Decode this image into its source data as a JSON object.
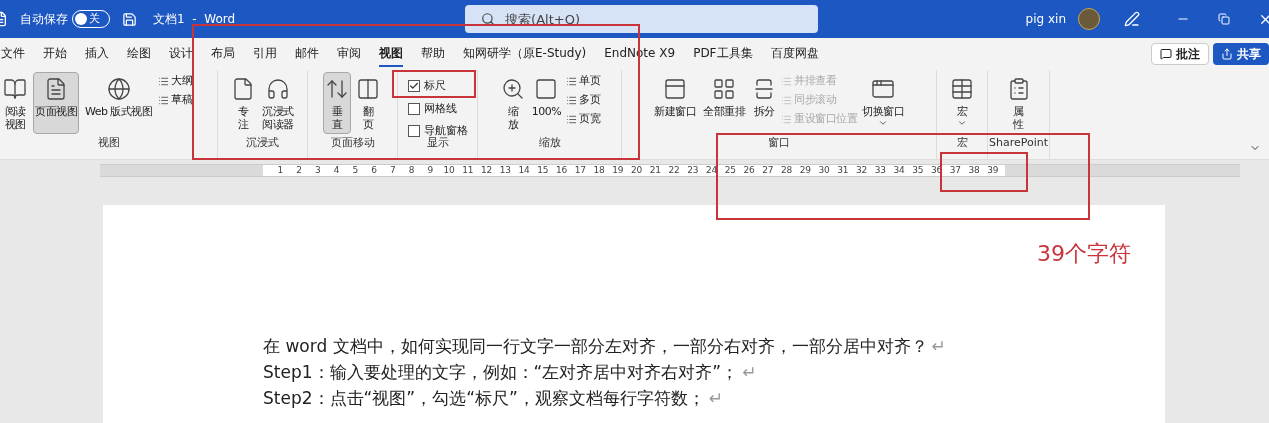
{
  "title_bar": {
    "autosave_label": "自动保存",
    "autosave_toggle": {
      "on": false,
      "label": "关"
    },
    "doc_title": "文档1  -  Word",
    "search": {
      "placeholder": "搜索(Alt+Q)"
    },
    "user_name": "pig xin"
  },
  "menu_tabs": [
    {
      "label": "文件",
      "selected": false
    },
    {
      "label": "开始",
      "selected": false
    },
    {
      "label": "插入",
      "selected": false
    },
    {
      "label": "绘图",
      "selected": false
    },
    {
      "label": "设计",
      "selected": false
    },
    {
      "label": "布局",
      "selected": false
    },
    {
      "label": "引用",
      "selected": false
    },
    {
      "label": "邮件",
      "selected": false
    },
    {
      "label": "审阅",
      "selected": false
    },
    {
      "label": "视图",
      "selected": true
    },
    {
      "label": "帮助",
      "selected": false
    },
    {
      "label": "知网研学（原E-Study)",
      "selected": false
    },
    {
      "label": "EndNote X9",
      "selected": false
    },
    {
      "label": "PDF工具集",
      "selected": false
    },
    {
      "label": "百度网盘",
      "selected": false
    }
  ],
  "right_buttons": [
    {
      "label": "批注",
      "kind": "comment"
    },
    {
      "label": "共享",
      "kind": "share"
    }
  ],
  "ribbon_groups": [
    {
      "label": "视图",
      "items": [
        {
          "kind": "large",
          "lines": [
            "阅读",
            "视图"
          ],
          "selected": false
        },
        {
          "kind": "large",
          "lines": [
            "页面视图"
          ],
          "selected": true
        },
        {
          "kind": "large",
          "lines": [
            "Web 版式视图"
          ],
          "selected": false
        },
        {
          "kind": "stack",
          "items": [
            {
              "label": "大纲",
              "disabled": false
            },
            {
              "label": "草稿",
              "disabled": false
            }
          ]
        }
      ]
    },
    {
      "label": "沉浸式",
      "items": [
        {
          "kind": "large",
          "lines": [
            "专",
            "注"
          ],
          "selected": false
        },
        {
          "kind": "large",
          "lines": [
            "沉浸式",
            "阅读器"
          ],
          "selected": false
        }
      ]
    },
    {
      "label": "页面移动",
      "items": [
        {
          "kind": "large",
          "lines": [
            "垂",
            "直"
          ],
          "selected": true
        },
        {
          "kind": "large",
          "lines": [
            "翻",
            "页"
          ],
          "selected": false
        }
      ]
    },
    {
      "label": "显示",
      "items": [
        {
          "kind": "checks",
          "items": [
            {
              "label": "标尺",
              "checked": true
            },
            {
              "label": "网格线",
              "checked": false
            },
            {
              "label": "导航窗格",
              "checked": false
            }
          ]
        }
      ]
    },
    {
      "label": "缩放",
      "items": [
        {
          "kind": "large",
          "lines": [
            "缩",
            "放"
          ],
          "selected": false
        },
        {
          "kind": "large",
          "lines": [
            "100%"
          ],
          "selected": false
        },
        {
          "kind": "stack",
          "items": [
            {
              "label": "单页",
              "disabled": false
            },
            {
              "label": "多页",
              "disabled": false
            },
            {
              "label": "页宽",
              "disabled": false
            }
          ]
        }
      ]
    },
    {
      "label": "窗口",
      "items": [
        {
          "kind": "large",
          "lines": [
            "新建窗口"
          ],
          "selected": false
        },
        {
          "kind": "large",
          "lines": [
            "全部重排"
          ],
          "selected": false
        },
        {
          "kind": "large",
          "lines": [
            "拆分"
          ],
          "selected": false
        },
        {
          "kind": "stack",
          "items": [
            {
              "label": "并排查看",
              "disabled": true
            },
            {
              "label": "同步滚动",
              "disabled": true
            },
            {
              "label": "重设窗口位置",
              "disabled": true
            }
          ]
        },
        {
          "kind": "dropdown",
          "lines": [
            "切换窗口"
          ],
          "selected": false
        }
      ]
    },
    {
      "label": "宏",
      "items": [
        {
          "kind": "dropdown",
          "lines": [
            "宏"
          ],
          "selected": false
        }
      ]
    },
    {
      "label": "SharePoint",
      "items": [
        {
          "kind": "large",
          "lines": [
            "属",
            "性"
          ],
          "selected": false
        }
      ]
    }
  ],
  "ruler": {
    "marks": [
      "1",
      "2",
      "3",
      "4",
      "5",
      "6",
      "7",
      "8",
      "9",
      "10",
      "11",
      "12",
      "13",
      "14",
      "15",
      "16",
      "17",
      "18",
      "19",
      "20",
      "21",
      "22",
      "23",
      "24",
      "25",
      "26",
      "27",
      "28",
      "29",
      "30",
      "31",
      "32",
      "33",
      "34",
      "35",
      "36",
      "37",
      "38",
      "39"
    ]
  },
  "document": {
    "lines": [
      {
        "text": "在 word 文档中，如何实现同一行文字一部分左对齐，一部分右对齐，一部分居中对齐？",
        "mark": "↵"
      },
      {
        "text": "Step1：输入要处理的文字，例如：“左对齐居中对齐右对齐”；",
        "mark": "↵"
      },
      {
        "text": "Step2：点击“视图”，勾选“标尺”，观察文档每行字符数；",
        "mark": "↵"
      }
    ]
  },
  "annotation": {
    "text": "39个字符"
  }
}
